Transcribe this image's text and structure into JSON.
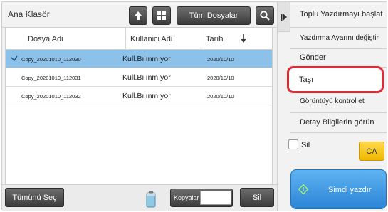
{
  "header": {
    "folder_title": "Ana Klasör",
    "up_icon": "arrow-up-icon",
    "grid_icon": "grid-icon",
    "all_folders_label": "Tüm Dosyalar",
    "search_icon": "search-icon"
  },
  "table": {
    "columns": [
      "Dosya Adi",
      "Kullanici Adi",
      "Tarıh"
    ],
    "sort_icon": "arrow-down-icon",
    "rows": [
      {
        "name": "Copy_20201010_112030",
        "user": "Kull.Bılınmıyor",
        "date": "2020/10/10",
        "selected": true
      },
      {
        "name": "Copy_20201010_112031",
        "user": "Kull.Bılınmıyor",
        "date": "2020/10/10",
        "selected": false
      },
      {
        "name": "Copy_20201010_112032",
        "user": "Kull.Bılınmıyor",
        "date": "2020/10/10",
        "selected": false
      }
    ]
  },
  "bottom_bar": {
    "select_all_label": "Tümünü Seç",
    "copies_label": "Kopyalar",
    "copies_value": "",
    "delete_label": "Sil"
  },
  "right_panel": {
    "menu": [
      "Toplu Yazdırmayı başlat",
      "Yazdırma Ayarını değiştir",
      "Gönder",
      "Taşı",
      "Görüntüyü kontrol et",
      "Detay Bilgilerin görün"
    ],
    "delete_checkbox_label": "Sil",
    "ca_label": "CA",
    "print_label": "Simdi yazdır"
  },
  "colors": {
    "selected_row": "#8cc1ea",
    "highlight": "#e02a36",
    "print_button": "#3a93e0",
    "ca_button": "#f7c517"
  }
}
